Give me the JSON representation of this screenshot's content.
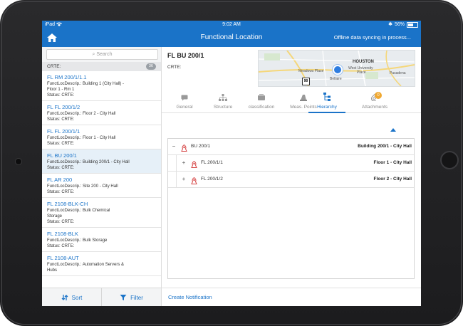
{
  "status_bar": {
    "carrier": "iPad",
    "time": "9:02 AM",
    "battery": "56%"
  },
  "nav": {
    "title": "Functional Location",
    "sync_text": "Offline data syncing in process..."
  },
  "search": {
    "placeholder": "Search"
  },
  "group": {
    "label": "CRTE:",
    "count": "36"
  },
  "list": [
    {
      "title": "FL RM 200/1/1.1",
      "lines": [
        "FunctLocDescrip.: Building 1 (City Hall) -",
        "Floor 1 - Rm 1",
        "Status: CRTE:"
      ]
    },
    {
      "title": "FL FL 200/1/2",
      "lines": [
        "FunctLocDescrip.: Floor 2 - City Hall",
        "Status: CRTE:"
      ]
    },
    {
      "title": "FL FL 200/1/1",
      "lines": [
        "FunctLocDescrip.: Floor 1 - City Hall",
        "Status: CRTE:"
      ]
    },
    {
      "title": "FL BU 200/1",
      "lines": [
        "FunctLocDescrip.: Building 200/1 - City Hall",
        "Status: CRTE:"
      ],
      "selected": true
    },
    {
      "title": "FL AR 200",
      "lines": [
        "FunctLocDescrip.: Site 200 - City Hall",
        "Status: CRTE:"
      ]
    },
    {
      "title": "FL 2108-BLK-CH",
      "lines": [
        "FunctLocDescrip.: Bulk Chemical",
        "Storage",
        "Status: CRTE:"
      ]
    },
    {
      "title": "FL 2108-BLK",
      "lines": [
        "FunctLocDescrip.: Bulk Storage",
        "Status: CRTE:"
      ]
    },
    {
      "title": "FL 2108-AUT",
      "lines": [
        "FunctLocDescrip.: Automation Servers &",
        "Hubs"
      ]
    }
  ],
  "bottom_bar": {
    "sort_label": "Sort",
    "filter_label": "Filter"
  },
  "detail": {
    "title": "FL BU 200/1",
    "attr_label": "CRTE:",
    "map_labels": [
      "HOUSTON",
      "West University",
      "Place",
      "Meadows Place",
      "Pasadena",
      "Bellaire"
    ],
    "map_sign": "90"
  },
  "tabs": [
    {
      "label": "General",
      "icon": "chat-icon"
    },
    {
      "label": "Structure",
      "icon": "structure-icon"
    },
    {
      "label": "classification",
      "icon": "classification-icon"
    },
    {
      "label": "Meas. Points",
      "icon": "meas-points-icon"
    },
    {
      "label": "Hierarchy",
      "icon": "hierarchy-icon",
      "active": true
    },
    {
      "label": "Attachments",
      "icon": "attachment-icon",
      "badge": "0"
    }
  ],
  "tree": [
    {
      "toggle": "−",
      "name": "BU 200/1",
      "desc": "Building 200/1 - City Hall",
      "level": 0
    },
    {
      "toggle": "+",
      "name": "FL 200/1/1",
      "desc": "Floor 1 - City Hall",
      "level": 1
    },
    {
      "toggle": "+",
      "name": "FL 200/1/2",
      "desc": "Floor 2 - City Hall",
      "level": 1
    }
  ],
  "footer": {
    "create_label": "Create Notification"
  },
  "colors": {
    "accent": "#1a73c8",
    "badge": "#f0a830",
    "node_icon": "#d64545"
  }
}
